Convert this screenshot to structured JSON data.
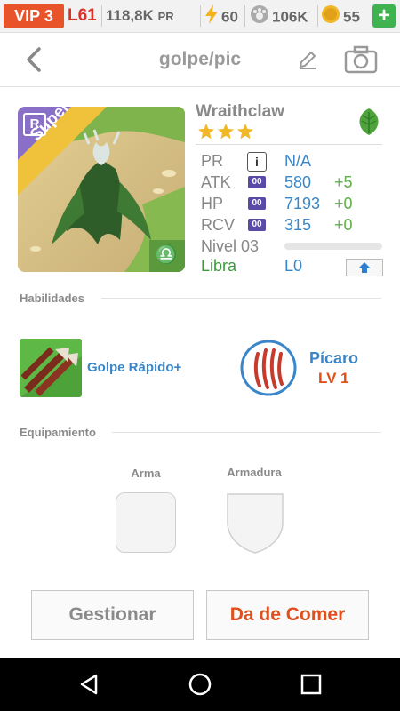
{
  "status_bar": {
    "vip": "VIP 3",
    "level": "L61",
    "power": "118,8K",
    "power_unit": "PR",
    "energy": "60",
    "paw": "106K",
    "coins": "55",
    "add_label": "+"
  },
  "header": {
    "title": "golpe/pic"
  },
  "card": {
    "rarity_letter": "R",
    "rarity": "Super",
    "sign_glyph": "♎"
  },
  "monster": {
    "name": "Wraithclaw",
    "stars": 3,
    "stats": [
      {
        "label": "PR",
        "badge": "i",
        "value": "N/A",
        "bonus": ""
      },
      {
        "label": "ATK",
        "badge": "00",
        "value": "580",
        "bonus": "+5"
      },
      {
        "label": "HP",
        "badge": "00",
        "value": "7193",
        "bonus": "+0"
      },
      {
        "label": "RCV",
        "badge": "00",
        "value": "315",
        "bonus": "+0"
      }
    ],
    "level_label": "Nivel 03",
    "level_progress": 0.0,
    "sign": "Libra",
    "rank": "L0"
  },
  "abilities": {
    "section_label": "Habilidades",
    "skill_name": "Golpe Rápido+",
    "class_name": "Pícaro",
    "class_level": "LV 1"
  },
  "equipment": {
    "section_label": "Equipamiento",
    "weapon_label": "Arma",
    "armor_label": "Armadura"
  },
  "actions": {
    "manage": "Gestionar",
    "feed": "Da de Comer"
  },
  "colors": {
    "accent_blue": "#3a86c8",
    "orange": "#e0501f",
    "green": "#3c9a3c",
    "vip": "#e8532a"
  }
}
